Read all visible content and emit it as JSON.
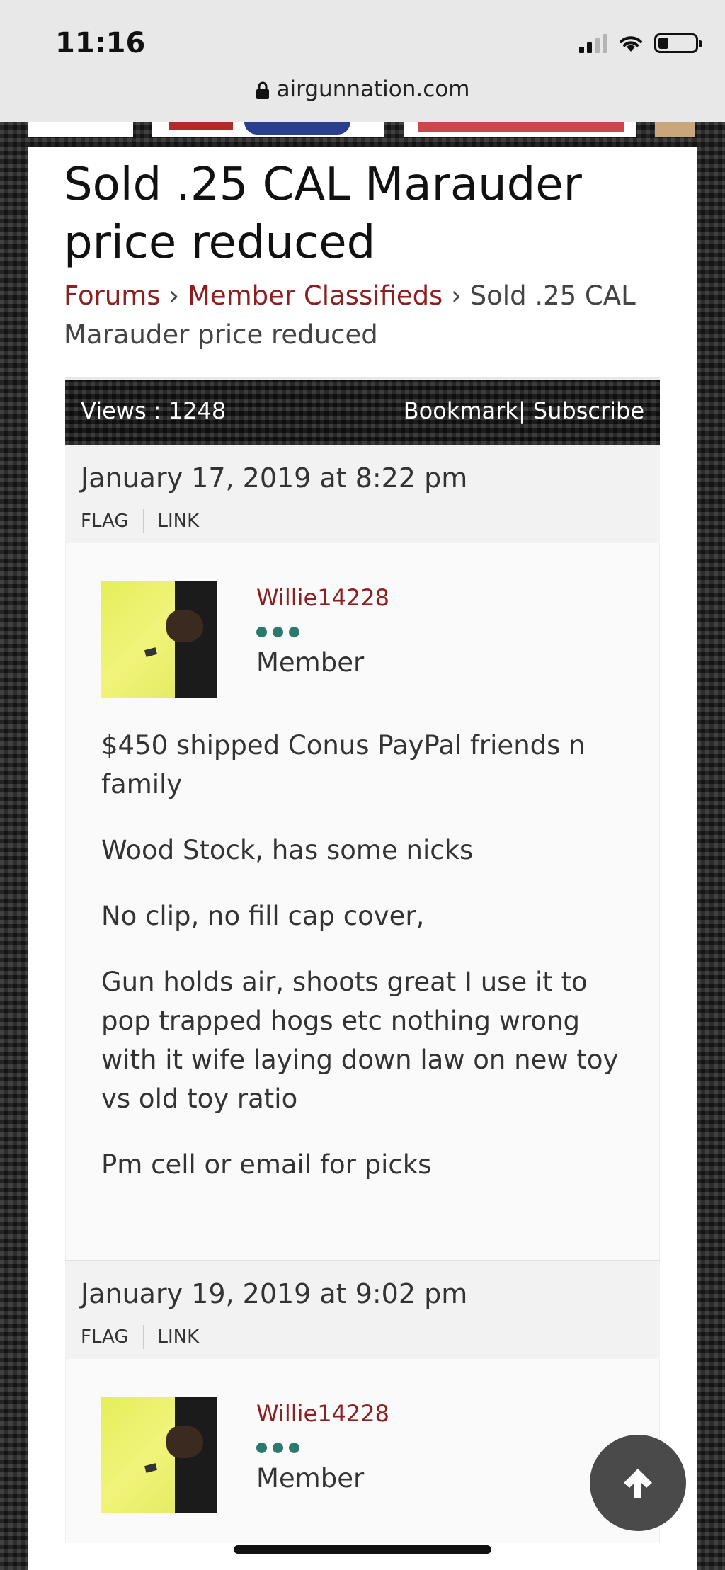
{
  "status_bar": {
    "time": "11:16",
    "url": "airgunnation.com"
  },
  "page": {
    "title": "Sold .25 CAL Marauder price reduced",
    "breadcrumb": {
      "forums": "Forums",
      "classifieds": "Member Classifieds",
      "separator": "›",
      "current": "Sold .25 CAL Marauder price reduced"
    }
  },
  "thread": {
    "views": "Views : 1248",
    "bookmark": "Bookmark",
    "action_sep": "|",
    "subscribe": "Subscribe"
  },
  "posts": [
    {
      "date": "January 17, 2019 at 8:22 pm",
      "flag": "FLAG",
      "link": "LINK",
      "author": "Willie14228",
      "role": "Member",
      "paragraphs": [
        "$450 shipped Conus PayPal friends n family",
        "Wood Stock, has some nicks",
        "No clip, no fill cap cover,",
        "Gun holds air, shoots great I use it to pop trapped hogs etc nothing wrong with it wife laying down law on new toy vs old toy ratio",
        "Pm cell or email for picks"
      ]
    },
    {
      "date": "January 19, 2019 at 9:02 pm",
      "flag": "FLAG",
      "link": "LINK",
      "author": "Willie14228",
      "role": "Member"
    }
  ],
  "colors": {
    "link": "#8c1f1f",
    "rank_dot": "#2b7a6c",
    "card": "#ffffff"
  },
  "icons": {
    "scroll_top": "arrow-up-icon",
    "lock": "lock-icon"
  }
}
